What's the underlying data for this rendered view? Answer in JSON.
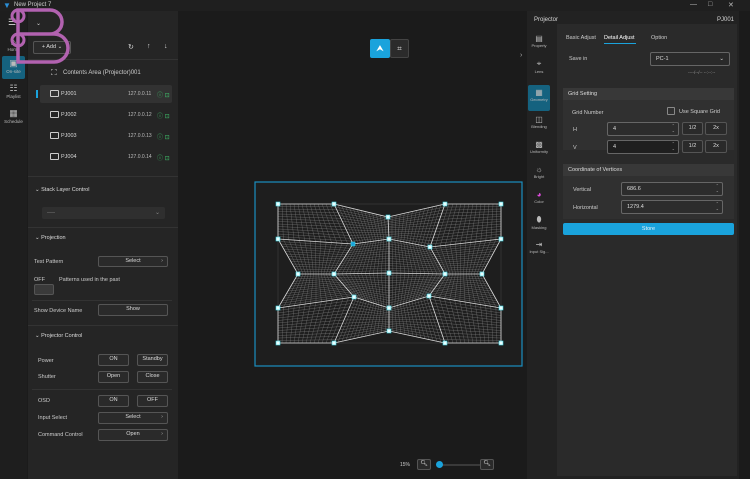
{
  "window": {
    "title": "New Project 7",
    "controls": [
      "—",
      "□",
      "✕"
    ]
  },
  "left_rail": [
    {
      "label": "Home",
      "icon": "home-icon"
    },
    {
      "label": "On-site",
      "icon": "onsite-icon",
      "active": true
    },
    {
      "label": "Playlist",
      "icon": "playlist-icon"
    },
    {
      "label": "Schedule",
      "icon": "schedule-icon"
    }
  ],
  "toolbar": {
    "add_label": "Add"
  },
  "tree": {
    "root": "Contents Area (Projector)001",
    "projectors": [
      {
        "name": "PJ001",
        "ip": "127.0.0.11"
      },
      {
        "name": "PJ002",
        "ip": "127.0.0.12"
      },
      {
        "name": "PJ003",
        "ip": "127.0.0.13"
      },
      {
        "name": "PJ004",
        "ip": "127.0.0.14"
      }
    ]
  },
  "stack": {
    "title": "Stack Layer Control",
    "value": "----"
  },
  "projection": {
    "title": "Projection",
    "test_pattern": "Test Pattern",
    "select": "Select",
    "off": "OFF",
    "past": "Patterns used in the past",
    "show_device": "Show Device Name",
    "show": "Show"
  },
  "control": {
    "title": "Projector Control",
    "power": "Power",
    "on": "ON",
    "standby": "Standby",
    "shutter": "Shutter",
    "open": "Open",
    "close": "Close",
    "osd": "OSD",
    "off": "OFF",
    "input_select": "Input Select",
    "select": "Select",
    "command": "Command Control",
    "cmd_open": "Open"
  },
  "canvas": {
    "zoom": "15%",
    "zoom_fraction": 0.05
  },
  "right": {
    "title": "Projector",
    "device": "PJ001",
    "rail": [
      {
        "label": "Property",
        "icon": "property-icon"
      },
      {
        "label": "Lens",
        "icon": "lens-icon"
      },
      {
        "label": "Geometry",
        "icon": "geometry-icon",
        "active": true
      },
      {
        "label": "Blending",
        "icon": "blending-icon"
      },
      {
        "label": "Uniformity",
        "icon": "uniformity-icon"
      },
      {
        "label": "Bright",
        "icon": "bright-icon"
      },
      {
        "label": "Color",
        "icon": "color-icon"
      },
      {
        "label": "Masking",
        "icon": "masking-icon"
      },
      {
        "label": "Input Sig...",
        "icon": "input-signal-icon"
      }
    ],
    "tabs": [
      "Basic Adjust",
      "Detail Adjust",
      "Option"
    ],
    "save_in_label": "Save in",
    "save_in": "PC-1",
    "date": "----/--/-- --:--:--",
    "grid": {
      "title": "Grid Setting",
      "number": "Grid Number",
      "square": "Use Square Grid",
      "h_label": "H",
      "h": "4",
      "v_label": "V",
      "v": "4",
      "half": "1/2",
      "double": "2x"
    },
    "coord": {
      "title": "Coordinate of Vertices",
      "vertical_label": "Vertical",
      "vertical": "686.6",
      "horizontal_label": "Horizontal",
      "horizontal": "1279.4"
    },
    "store": "Store"
  },
  "colors": {
    "accent": "#1aa3dc",
    "status": "#3fbf6a"
  }
}
